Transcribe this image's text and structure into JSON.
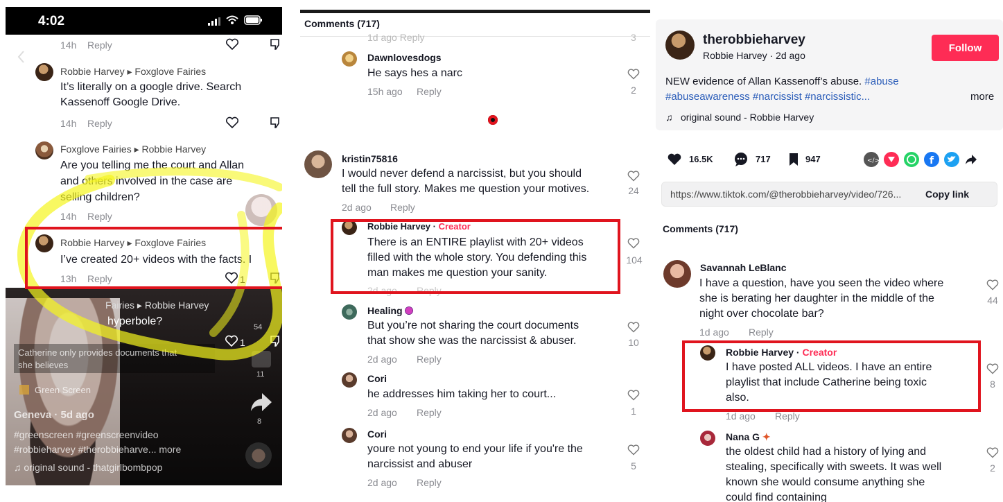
{
  "left_panel": {
    "status_time": "4:02",
    "comments": [
      {
        "meta_time": "14h",
        "reply": "Reply"
      },
      {
        "author": "Robbie Harvey",
        "reply_to": "Foxglove Fairies",
        "text_lines": [
          "It’s literally on a google drive. Search",
          "Kassenoff Google Drive."
        ],
        "meta_time": "14h",
        "reply": "Reply"
      },
      {
        "author": "Foxglove Fairies",
        "reply_to": "Robbie Harvey",
        "text_lines": [
          "Are you telling me the court and Allan",
          "and others involved in the case are",
          "selling children?"
        ],
        "meta_time": "14h",
        "reply": "Reply"
      },
      {
        "author": "Robbie Harvey",
        "reply_to": "Foxglove Fairies",
        "text_lines": [
          "I’ve created 20+ videos with the facts. I"
        ],
        "meta_time": "13h",
        "reply": "Reply",
        "likes": "1"
      },
      {
        "author_partial": "Fairies",
        "reply_to": "Robbie Harvey",
        "text_lines": [
          "hyperbole?"
        ],
        "likes": "1"
      }
    ],
    "overlay": {
      "caption_line1": "Catherine only provides documents that",
      "caption_line2": "she believes",
      "effect": "Green Screen",
      "user": "Geneva",
      "date": "5d ago",
      "tags_line1": "#greenscreen #greenscreenvideo",
      "tags_line2": "#robbieharvey #therobbieharve... more",
      "sound": "original sound - thatgirlbombpop",
      "count_a": "11",
      "count_b": "8",
      "count_c": "54"
    }
  },
  "middle_panel": {
    "header": "Comments (717)",
    "partial_top": "1d ago   Reply",
    "comments": [
      {
        "author": "Dawnlovesdogs",
        "text_lines": [
          "He says hes a narc"
        ],
        "time": "15h ago",
        "reply": "Reply",
        "likes": "2"
      },
      {
        "author": "kristin75816",
        "text_lines": [
          "I would never defend a narcissist, but you should",
          "tell the full story. Makes me question your motives."
        ],
        "time": "2d ago",
        "reply": "Reply",
        "likes": "24"
      },
      {
        "author": "Robbie Harvey",
        "badge": "Creator",
        "text_lines": [
          "There is an ENTIRE playlist with 20+ videos",
          "filled with the whole story. You defending this",
          "man makes me question your sanity."
        ],
        "time": "2d ago",
        "reply": "Reply",
        "likes": "104"
      },
      {
        "author": "Healing",
        "text_lines": [
          "But you’re not sharing the court documents",
          "that show she was the narcissist & abuser."
        ],
        "time": "2d ago",
        "reply": "Reply",
        "likes": "10"
      },
      {
        "author": "Cori",
        "text_lines": [
          "he addresses him taking her to court..."
        ],
        "time": "2d ago",
        "reply": "Reply",
        "likes": "1"
      },
      {
        "author": "Cori",
        "text_lines": [
          "youre not young to end your life if you're the",
          "narcissist and abuser"
        ],
        "time": "2d ago",
        "reply": "Reply",
        "likes": "5"
      }
    ]
  },
  "right_panel": {
    "username": "therobbieharvey",
    "subline": "Robbie Harvey · 2d ago",
    "follow_label": "Follow",
    "desc_plain": "NEW evidence of Allan Kassenoff’s abuse. ",
    "desc_tag1": "#abuse",
    "desc_tags2": "#abuseawareness #narcissist #narcissistic...",
    "more": "more",
    "sound": "original sound - Robbie Harvey",
    "likes": "16.5K",
    "comments_count": "717",
    "saves": "947",
    "link": "https://www.tiktok.com/@therobbieharvey/video/726...",
    "copy_link": "Copy link",
    "comments_header": "Comments (717)",
    "comments": [
      {
        "author": "Savannah LeBlanc",
        "text_lines": [
          "I have a question, have you seen the video where",
          "she is berating her daughter in the middle of the",
          "night over chocolate bar?"
        ],
        "time": "1d ago",
        "reply": "Reply",
        "likes": "44"
      },
      {
        "author": "Robbie Harvey",
        "badge": "Creator",
        "text_lines": [
          "I have posted ALL videos. I have an entire",
          "playlist that include Catherine being toxic",
          "also."
        ],
        "time": "1d ago",
        "reply": "Reply",
        "likes": "8"
      },
      {
        "author": "Nana G",
        "text_lines": [
          "the oldest child had a history of lying and",
          "stealing, specifically with sweets. It was well",
          "known she would consume anything she",
          "could find containing"
        ],
        "likes": "2"
      }
    ],
    "accent_color": "#fe2c55",
    "hashtag_color": "#2b5db9"
  },
  "highlight_color": "#e0141e"
}
